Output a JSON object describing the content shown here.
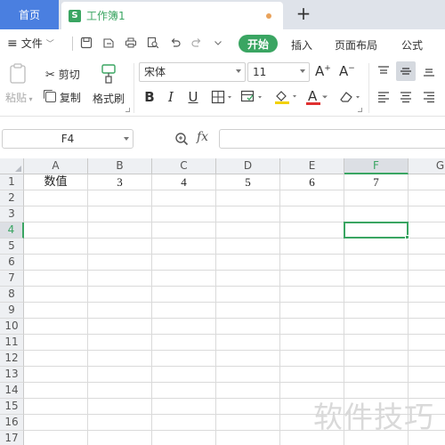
{
  "tabs": {
    "home": "首页",
    "document": "工作簿1",
    "doc_icon_letter": "S",
    "new_tab": "+"
  },
  "menu": {
    "file": "文件",
    "items": [
      "开始",
      "插入",
      "页面布局",
      "公式"
    ]
  },
  "ribbon": {
    "paste": "粘贴",
    "cut": "剪切",
    "copy": "复制",
    "format_painter": "格式刷",
    "font_name": "宋体",
    "font_size": "11",
    "increase_font": "A",
    "decrease_font": "A",
    "bold": "B",
    "italic": "I",
    "underline": "U",
    "font_color_letter": "A"
  },
  "formula_bar": {
    "name_box": "F4",
    "fx": "fx",
    "formula": ""
  },
  "sheet": {
    "columns": [
      "A",
      "B",
      "C",
      "D",
      "E",
      "F",
      "G"
    ],
    "rows": [
      "1",
      "2",
      "3",
      "4",
      "5",
      "6",
      "7",
      "8",
      "9",
      "10",
      "11",
      "12",
      "13",
      "14",
      "15",
      "16",
      "17"
    ],
    "active_cell": "F4",
    "row1_values": [
      "数值",
      "3",
      "4",
      "5",
      "6",
      "7"
    ]
  },
  "watermark": "软件技巧",
  "colors": {
    "accent": "#3aa562",
    "home_tab": "#4a7fe0",
    "modified_dot": "#e9a25b",
    "font_color_bar": "#e03030",
    "fill_color_bar": "#f2d100"
  }
}
